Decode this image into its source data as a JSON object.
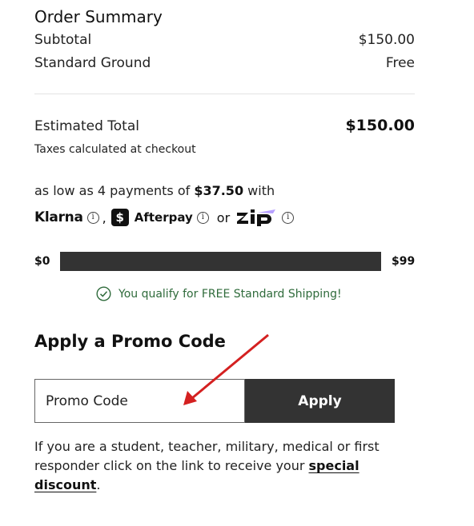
{
  "summary": {
    "title": "Order Summary",
    "subtotal_label": "Subtotal",
    "subtotal_value": "$150.00",
    "shipping_label": "Standard Ground",
    "shipping_value": "Free",
    "total_label": "Estimated Total",
    "total_value": "$150.00",
    "taxes_note": "Taxes calculated at checkout"
  },
  "installments": {
    "prefix": "as low as 4 payments of ",
    "amount": "$37.50",
    "suffix": " with",
    "providers": {
      "klarna": "Klarna",
      "comma": ",",
      "afterpay_badge": "$",
      "afterpay": "Afterpay",
      "or": "or",
      "zip": "zip"
    },
    "info_glyph": "i"
  },
  "shipping_progress": {
    "min_label": "$0",
    "max_label": "$99",
    "progress_fraction": 1.0,
    "message": "You qualify for FREE Standard Shipping!"
  },
  "promo": {
    "title": "Apply a Promo Code",
    "placeholder": "Promo Code",
    "value": "",
    "apply_label": "Apply",
    "note_text": "If you are a student, teacher, military, medical or first responder click on the link to receive your ",
    "link_text": "special discount",
    "note_end": "."
  },
  "colors": {
    "dark": "#333333",
    "success": "#2f6b3b",
    "annotation_arrow": "#d42020"
  }
}
